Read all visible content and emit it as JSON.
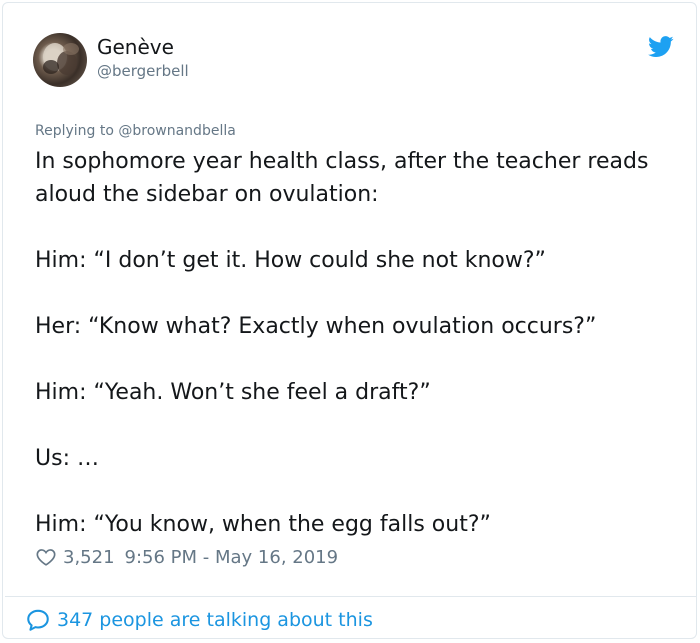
{
  "author": {
    "display_name": "Genève",
    "handle": "@bergerbell"
  },
  "reply": {
    "text": "Replying to @brownandbella"
  },
  "tweet": {
    "paragraphs": [
      "In sophomore year health class, after the teacher reads aloud the sidebar on ovulation:",
      "Him: “I don’t get it. How could she not know?”",
      "Her: “Know what? Exactly when ovulation occurs?”",
      "Him: “Yeah. Won’t she feel a draft?”",
      "Us: …",
      "Him: “You know, when the egg falls out?”"
    ]
  },
  "meta": {
    "likes": "3,521",
    "timestamp": "9:56 PM - May 16, 2019"
  },
  "footer": {
    "conversation": "347 people are talking about this"
  },
  "icons": {
    "brand": "twitter-bird-icon",
    "like": "heart-icon",
    "reply": "speech-bubble-icon"
  },
  "colors": {
    "accent": "#1da1f2",
    "link": "#1b95e0",
    "secondary_text": "#657786",
    "primary_text": "#14171a"
  }
}
